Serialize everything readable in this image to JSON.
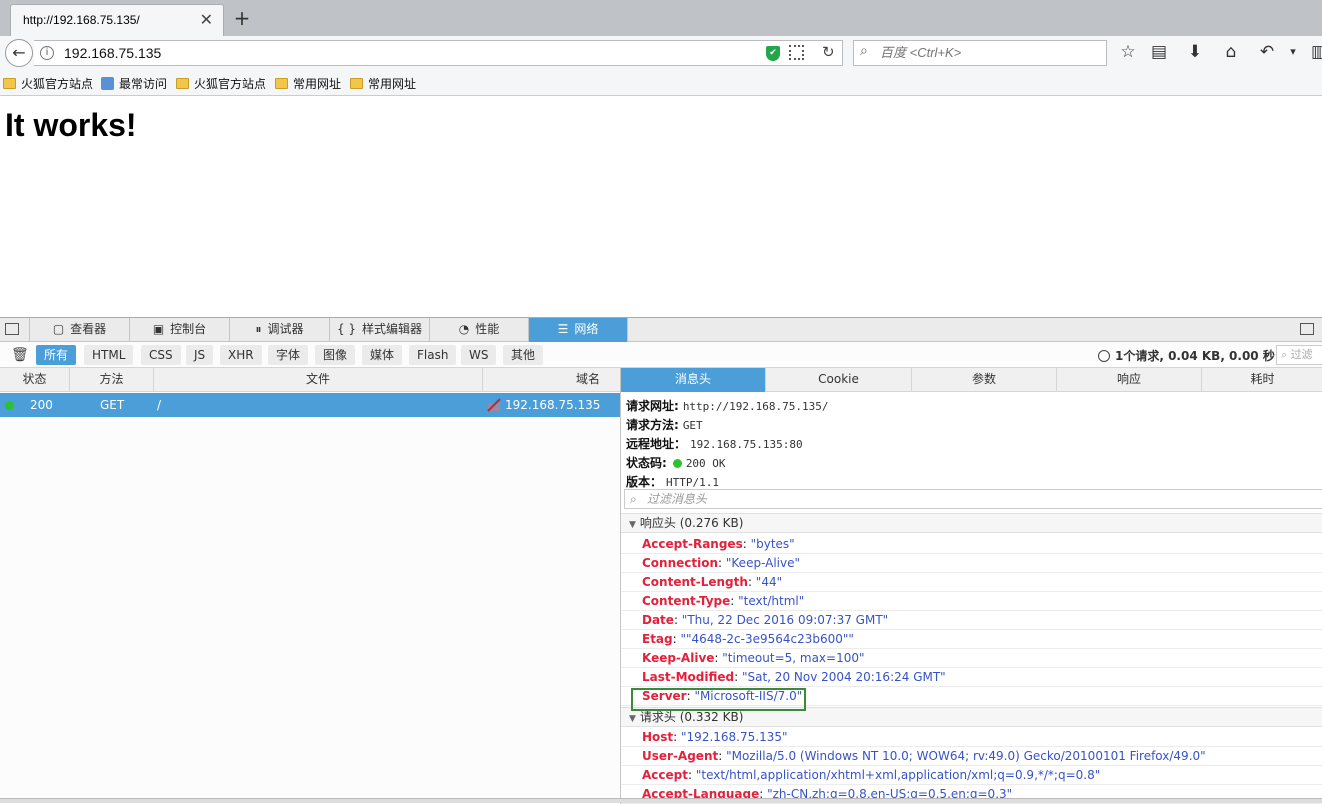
{
  "browser": {
    "tab_title": "http://192.168.75.135/",
    "tab_close": "✕",
    "new_tab": "+",
    "back_glyph": "←",
    "info_glyph": "i",
    "url": "192.168.75.135",
    "shield_glyph": "✔",
    "reload_glyph": "↻",
    "search_icon_glyph": "⌕",
    "search_placeholder": "百度 <Ctrl+K>",
    "toolbar_icons": [
      "☆",
      "▤",
      "⬇",
      "⌂",
      "↶",
      "▾",
      "▥"
    ]
  },
  "bookmarks": [
    "火狐官方站点",
    "最常访问",
    "火狐官方站点",
    "常用网址",
    "常用网址"
  ],
  "page": {
    "heading": "It works!"
  },
  "devtools": {
    "tabs": [
      {
        "icon": "▢",
        "label": "查看器"
      },
      {
        "icon": "▣",
        "label": "控制台"
      },
      {
        "icon": "⏸",
        "label": "调试器"
      },
      {
        "icon": "{ }",
        "label": "样式编辑器"
      },
      {
        "icon": "◔",
        "label": "性能"
      },
      {
        "icon": "☰",
        "label": "网络"
      }
    ],
    "active_tab": "网络",
    "trash_glyph": "🗑",
    "filters": [
      "所有",
      "HTML",
      "CSS",
      "JS",
      "XHR",
      "字体",
      "图像",
      "媒体",
      "Flash",
      "WS",
      "其他"
    ],
    "active_filter": "所有",
    "summary": "1个请求, 0.04 KB, 0.00 秒",
    "filter_url_placeholder": "⌕ 过滤",
    "columns": [
      "状态",
      "方法",
      "文件",
      "域名"
    ],
    "request": {
      "status": "200",
      "method": "GET",
      "file": "/",
      "domain": "192.168.75.135"
    },
    "detail_tabs": [
      "消息头",
      "Cookie",
      "参数",
      "响应",
      "耗时"
    ],
    "active_detail_tab": "消息头",
    "summary_lines": [
      {
        "label": "请求网址:",
        "value": "http://192.168.75.135/"
      },
      {
        "label": "请求方法:",
        "value": "GET"
      },
      {
        "label": "远程地址：",
        "value": "192.168.75.135:80"
      },
      {
        "label": "状态码:",
        "value": "200 OK"
      },
      {
        "label": "版本：",
        "value": "HTTP/1.1"
      }
    ],
    "header_filter_placeholder": "过滤消息头",
    "header_filter_icon": "⌕",
    "section_glyph": "▼",
    "response_section": "响应头 (0.276 KB)",
    "response_headers": [
      {
        "name": "Accept-Ranges",
        "value": "\"bytes\""
      },
      {
        "name": "Connection",
        "value": "\"Keep-Alive\""
      },
      {
        "name": "Content-Length",
        "value": "\"44\""
      },
      {
        "name": "Content-Type",
        "value": "\"text/html\""
      },
      {
        "name": "Date",
        "value": "\"Thu, 22 Dec 2016 09:07:37 GMT\""
      },
      {
        "name": "Etag",
        "value": "\"\"4648-2c-3e9564c23b600\"\""
      },
      {
        "name": "Keep-Alive",
        "value": "\"timeout=5, max=100\""
      },
      {
        "name": "Last-Modified",
        "value": "\"Sat, 20 Nov 2004 20:16:24 GMT\""
      },
      {
        "name": "Server",
        "value": "\"Microsoft-IIS/7.0\""
      }
    ],
    "request_section": "请求头 (0.332 KB)",
    "request_headers": [
      {
        "name": "Host",
        "value": "\"192.168.75.135\""
      },
      {
        "name": "User-Agent",
        "value": "\"Mozilla/5.0 (Windows NT 10.0; WOW64; rv:49.0) Gecko/20100101 Firefox/49.0\""
      },
      {
        "name": "Accept",
        "value": "\"text/html,application/xhtml+xml,application/xml;q=0.9,*/*;q=0.8\""
      },
      {
        "name": "Accept-Language",
        "value": "\"zh-CN,zh;q=0.8,en-US;q=0.5,en;q=0.3\""
      }
    ]
  },
  "colors": {
    "accent": "#4c9ed9",
    "header_name": "#e3213b",
    "header_value": "#3753c7",
    "highlight_box": "#3a8a3a"
  }
}
